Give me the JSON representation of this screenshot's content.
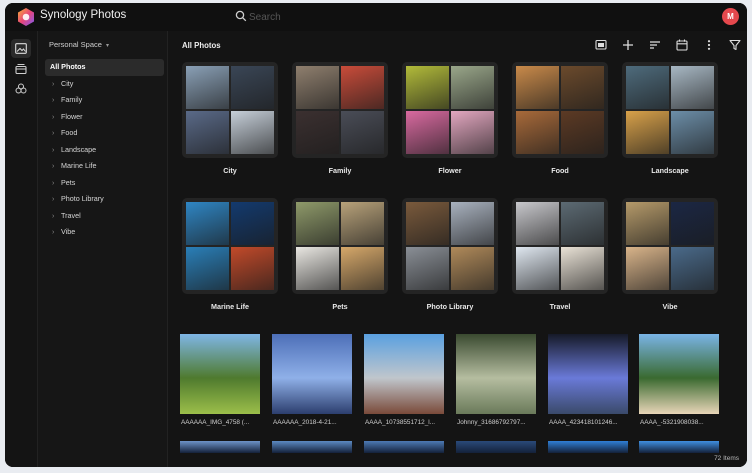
{
  "app": {
    "title": "Synology Photos",
    "search_placeholder": "Search",
    "avatar_initial": "M",
    "avatar_color": "#e5484d"
  },
  "rail": [
    "photo-icon",
    "shared-space-icon",
    "albums-icon"
  ],
  "sidebar": {
    "space": "Personal Space",
    "items": [
      {
        "label": "All Photos",
        "selected": true
      },
      {
        "label": "City"
      },
      {
        "label": "Family"
      },
      {
        "label": "Flower"
      },
      {
        "label": "Food"
      },
      {
        "label": "Landscape"
      },
      {
        "label": "Marine Life"
      },
      {
        "label": "Pets"
      },
      {
        "label": "Photo Library"
      },
      {
        "label": "Travel"
      },
      {
        "label": "Vibe"
      }
    ]
  },
  "main": {
    "title": "All Photos",
    "toolbar": [
      "slideshow-icon",
      "add-icon",
      "sort-icon",
      "calendar-icon",
      "more-icon",
      "filter-icon"
    ],
    "albums": [
      {
        "name": "City",
        "colors": [
          "#8aa0b6",
          "#3a4656",
          "#5a6a88",
          "#c6cfd9"
        ]
      },
      {
        "name": "Family",
        "colors": [
          "#8f7f6e",
          "#c94c3a",
          "#3b3030",
          "#4a4d57"
        ]
      },
      {
        "name": "Flower",
        "colors": [
          "#b2bb3a",
          "#9aa78a",
          "#d96aa0",
          "#e3a7c0"
        ]
      },
      {
        "name": "Food",
        "colors": [
          "#c98a4a",
          "#6b4a2c",
          "#a86a3a",
          "#5c3a24"
        ]
      },
      {
        "name": "Landscape",
        "colors": [
          "#4e6b7c",
          "#a8b8c4",
          "#d8a14a",
          "#6c8ea8"
        ]
      },
      {
        "name": "Marine Life",
        "colors": [
          "#2f86c4",
          "#133a6e",
          "#2a7fb8",
          "#c24a2a"
        ]
      },
      {
        "name": "Pets",
        "colors": [
          "#8f9a6a",
          "#b8a27a",
          "#e9e7e2",
          "#d6a86a"
        ]
      },
      {
        "name": "Photo Library",
        "colors": [
          "#7a5a3c",
          "#a9b2bf",
          "#8a8f96",
          "#b08a5a"
        ]
      },
      {
        "name": "Travel",
        "colors": [
          "#c8c8cc",
          "#5c6a73",
          "#dfe7f0",
          "#e9e2d6"
        ]
      },
      {
        "name": "Vibe",
        "colors": [
          "#b59a6a",
          "#1b2744",
          "#d9b48a",
          "#4a6a8a"
        ]
      }
    ],
    "photos": [
      {
        "name": "AAAAAA_IMG_4758 (...",
        "colors": [
          "#7fb6e6",
          "#4f7a2e",
          "#9cbf4a"
        ]
      },
      {
        "name": "AAAAAA_2018-4-21...",
        "colors": [
          "#4d6fb8",
          "#8fb0e8",
          "#2c3e6e"
        ]
      },
      {
        "name": "AAAA_10738551712_l...",
        "colors": [
          "#5aa0e0",
          "#c0c6cc",
          "#7a4a3a"
        ]
      },
      {
        "name": "Johnny_31686792797...",
        "colors": [
          "#3a4a30",
          "#b5bda0",
          "#6a7a5a"
        ]
      },
      {
        "name": "AAAA_423418101246...",
        "colors": [
          "#161a28",
          "#6a7ad8",
          "#3a4a6a"
        ]
      },
      {
        "name": "AAAA_-5321908038...",
        "colors": [
          "#7ab4e6",
          "#3a6a30",
          "#e8d6b8"
        ]
      }
    ],
    "partial_colors": [
      "#6d93c8",
      "#5c8ac2",
      "#4d7ab4",
      "#2a4a7a",
      "#2f7fd6",
      "#3f8fe0"
    ],
    "item_count": "72 Items"
  }
}
